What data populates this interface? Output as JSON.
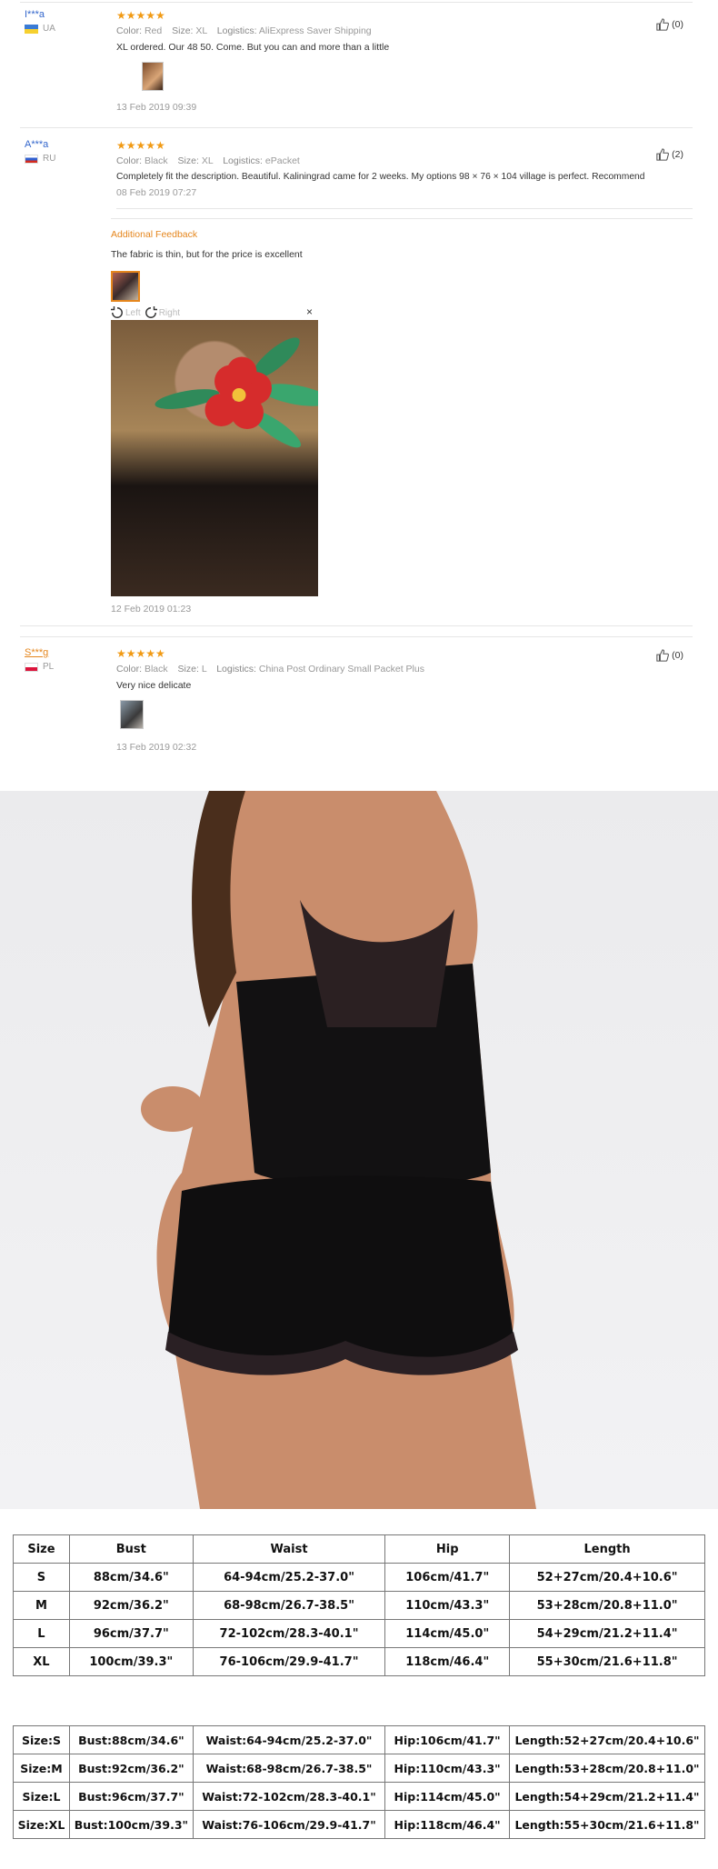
{
  "reviews": [
    {
      "user": "I***a",
      "country": "UA",
      "attrs": {
        "color_label": "Color:",
        "color": "Red",
        "size_label": "Size:",
        "size": "XL",
        "logistics_label": "Logistics:",
        "logistics": "AliExpress Saver Shipping"
      },
      "rating": "★★★★★",
      "text": "XL ordered. Our 48 50. Come. But you can and more than a little",
      "date": "13 Feb 2019 09:39",
      "helpful": "(0)"
    },
    {
      "user": "A***a",
      "country": "RU",
      "attrs": {
        "color_label": "Color:",
        "color": "Black",
        "size_label": "Size:",
        "size": "XL",
        "logistics_label": "Logistics:",
        "logistics": "ePacket"
      },
      "rating": "★★★★★",
      "text": "Completely fit the description. Beautiful. Kaliningrad came for 2 weeks. My options 98 × 76 × 104 village is perfect. Recommend",
      "date": "08 Feb 2019 07:27",
      "helpful": "(2)",
      "additional": {
        "heading": "Additional Feedback",
        "text": "The fabric is thin, but for the price is excellent",
        "date": "12 Feb 2019 01:23",
        "rotate_left": "Left",
        "rotate_right": "Right",
        "close": "×"
      }
    },
    {
      "user": "S***g",
      "country": "PL",
      "attrs": {
        "color_label": "Color:",
        "color": "Black",
        "size_label": "Size:",
        "size": "L",
        "logistics_label": "Logistics:",
        "logistics": "China Post Ordinary Small Packet Plus"
      },
      "rating": "★★★★★",
      "text": "Very nice delicate",
      "date": "13 Feb 2019 02:32",
      "helpful": "(0)"
    }
  ],
  "size_table": {
    "headers": [
      "Size",
      "Bust",
      "Waist",
      "Hip",
      "Length"
    ],
    "rows": [
      [
        "S",
        "88cm/34.6\"",
        "64-94cm/25.2-37.0\"",
        "106cm/41.7\"",
        "52+27cm/20.4+10.6\""
      ],
      [
        "M",
        "92cm/36.2\"",
        "68-98cm/26.7-38.5\"",
        "110cm/43.3\"",
        "53+28cm/20.8+11.0\""
      ],
      [
        "L",
        "96cm/37.7\"",
        "72-102cm/28.3-40.1\"",
        "114cm/45.0\"",
        "54+29cm/21.2+11.4\""
      ],
      [
        "XL",
        "100cm/39.3\"",
        "76-106cm/29.9-41.7\"",
        "118cm/46.4\"",
        "55+30cm/21.6+11.8\""
      ]
    ]
  },
  "size_table2": {
    "rows": [
      [
        "Size:S",
        "Bust:88cm/34.6\"",
        "Waist:64-94cm/25.2-37.0\"",
        "Hip:106cm/41.7\"",
        "Length:52+27cm/20.4+10.6\""
      ],
      [
        "Size:M",
        "Bust:92cm/36.2\"",
        "Waist:68-98cm/26.7-38.5\"",
        "Hip:110cm/43.3\"",
        "Length:53+28cm/20.8+11.0\""
      ],
      [
        "Size:L",
        "Bust:96cm/37.7\"",
        "Waist:72-102cm/28.3-40.1\"",
        "Hip:114cm/45.0\"",
        "Length:54+29cm/21.2+11.4\""
      ],
      [
        "Size:XL",
        "Bust:100cm/39.3\"",
        "Waist:76-106cm/29.9-41.7\"",
        "Hip:118cm/46.4\"",
        "Length:55+30cm/21.6+11.8\""
      ]
    ]
  }
}
